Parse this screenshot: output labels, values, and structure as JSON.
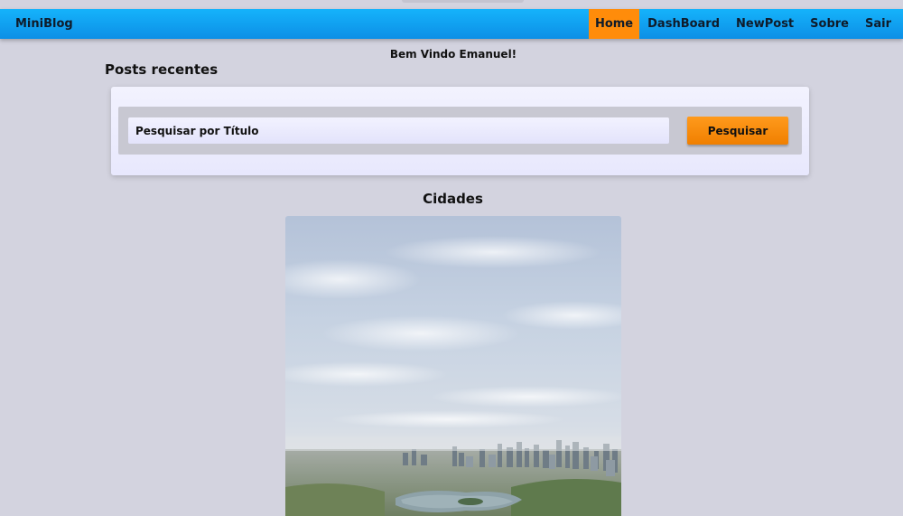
{
  "header": {
    "brand": "MiniBlog",
    "nav": [
      {
        "label": "Home",
        "active": true
      },
      {
        "label": "DashBoard",
        "active": false
      },
      {
        "label": "NewPost",
        "active": false
      },
      {
        "label": "Sobre",
        "active": false
      },
      {
        "label": "Sair",
        "active": false
      }
    ]
  },
  "welcome": "Bem Vindo Emanuel!",
  "section_title": "Posts recentes",
  "search": {
    "placeholder": "Pesquisar por Título",
    "button_label": "Pesquisar"
  },
  "post": {
    "title": "Cidades"
  },
  "colors": {
    "navbar": "#15b3fb",
    "active_nav": "#ff8c0a",
    "button": "#f58a0c",
    "page_background": "#d3d3df"
  }
}
